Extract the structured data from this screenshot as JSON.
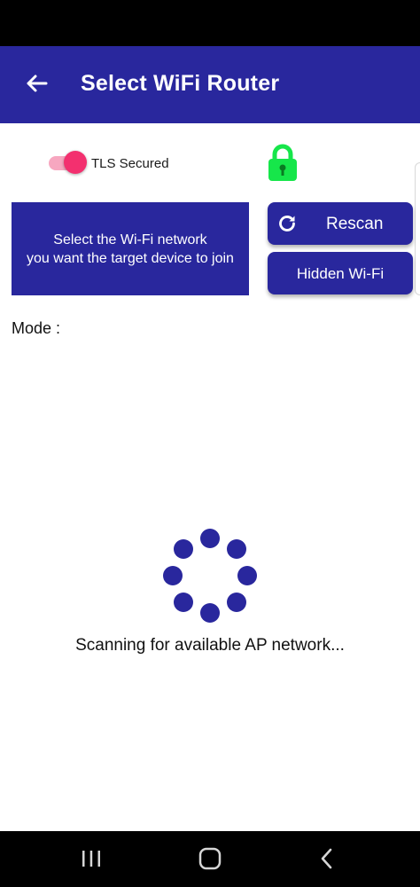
{
  "app_bar": {
    "title": "Select WiFi Router",
    "back_icon": "arrow-left-icon",
    "background": "#29279d"
  },
  "tls": {
    "label": "TLS Secured",
    "enabled": true,
    "toggle_color": "#f3306f",
    "lock_icon": "lock-closed-icon",
    "lock_color": "#16e64a"
  },
  "info": {
    "line1": "Select the Wi-Fi network",
    "line2": "you want the target device to join"
  },
  "buttons": {
    "rescan_label": "Rescan",
    "rescan_icon": "refresh-icon",
    "hidden_label": "Hidden Wi-Fi"
  },
  "mode": {
    "label": "Mode :"
  },
  "scanning": {
    "message": "Scanning for available AP network...",
    "spinner_color": "#29279d"
  },
  "nav_bar": {
    "recents_icon": "recents-icon",
    "home_icon": "home-icon",
    "back_icon": "back-chevron-icon"
  }
}
